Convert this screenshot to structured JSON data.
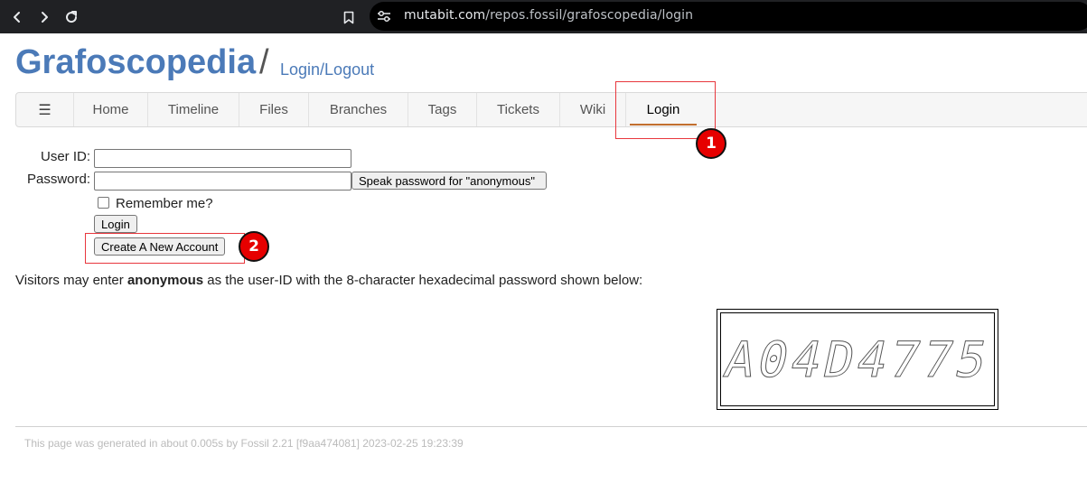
{
  "browser": {
    "url": "mutabit.com/repos.fossil/grafoscopedia/login",
    "url_host": "mutabit.com",
    "url_path": "/repos.fossil/grafoscopedia/login"
  },
  "header": {
    "site_title": "Grafoscopedia",
    "separator": "/",
    "page_title": "Login/Logout"
  },
  "menu": {
    "hamburger": "☰",
    "items": [
      {
        "label": "Home"
      },
      {
        "label": "Timeline"
      },
      {
        "label": "Files"
      },
      {
        "label": "Branches"
      },
      {
        "label": "Tags"
      },
      {
        "label": "Tickets"
      },
      {
        "label": "Wiki"
      },
      {
        "label": "Login",
        "active": true
      }
    ]
  },
  "annotations": {
    "badge1": "1",
    "badge2": "2",
    "color": "#e60000"
  },
  "form": {
    "user_id_label": "User ID:",
    "user_id_value": "",
    "password_label": "Password:",
    "password_value": "",
    "speak_button": "Speak password for \"anonymous\"",
    "remember_label": "Remember me?",
    "remember_checked": false,
    "login_button": "Login",
    "create_account_button": "Create A New Account"
  },
  "info": {
    "prefix": "Visitors may enter ",
    "user": "anonymous",
    "suffix": " as the user-ID with the 8-character hexadecimal password shown below:"
  },
  "captcha": {
    "text": "A04D4775"
  },
  "footer": {
    "text": "This page was generated in about 0.005s by Fossil 2.21 [f9aa474081] 2023-02-25 19:23:39"
  },
  "colors": {
    "link": "#4b7ab8",
    "active_underline": "#c26f2f",
    "annotation": "#e8373d"
  }
}
